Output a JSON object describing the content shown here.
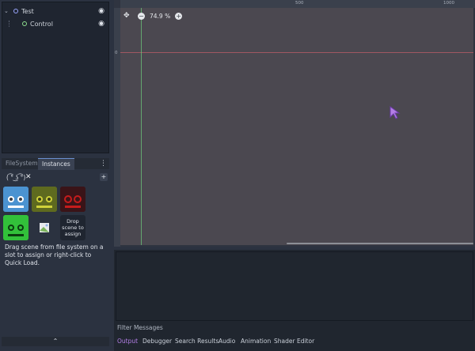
{
  "scene_tree": {
    "nodes": [
      {
        "name": "Test",
        "color": "#9aa6ff"
      },
      {
        "name": "Control",
        "color": "#8fe08f"
      }
    ]
  },
  "dock": {
    "tabs": [
      "FileSystem",
      "Instances"
    ],
    "active_tab": "Instances",
    "emoticon": "( ͡° ͜ʖ ͡°)",
    "close_symbol": "✕",
    "add_symbol": "+",
    "drop_tile_text": "Drop scene to assign",
    "help_text": "Drag scene from file system on a slot to assign or right-click to Quick Load.",
    "collapse_symbol": "⌃"
  },
  "viewport": {
    "zoom": "74.9 %",
    "ruler_marks": [
      "500",
      "1000"
    ],
    "ruler_vertical_mark": "0",
    "zoom_minus": "−",
    "zoom_plus": "+"
  },
  "bottom_panel": {
    "filter_placeholder": "Filter Messages",
    "tabs": [
      "Output",
      "Debugger",
      "Search Results",
      "Audio",
      "Animation",
      "Shader Editor"
    ],
    "active_tab": "Output"
  },
  "colors": {
    "accent": "#b37ee6",
    "origin_red": "#c45e6a",
    "origin_green": "#6fcf7c",
    "tile_blue": "#4b93d1",
    "tile_yellow": "#cfd23a",
    "tile_red": "#c51c1c",
    "tile_green": "#32c13a"
  }
}
